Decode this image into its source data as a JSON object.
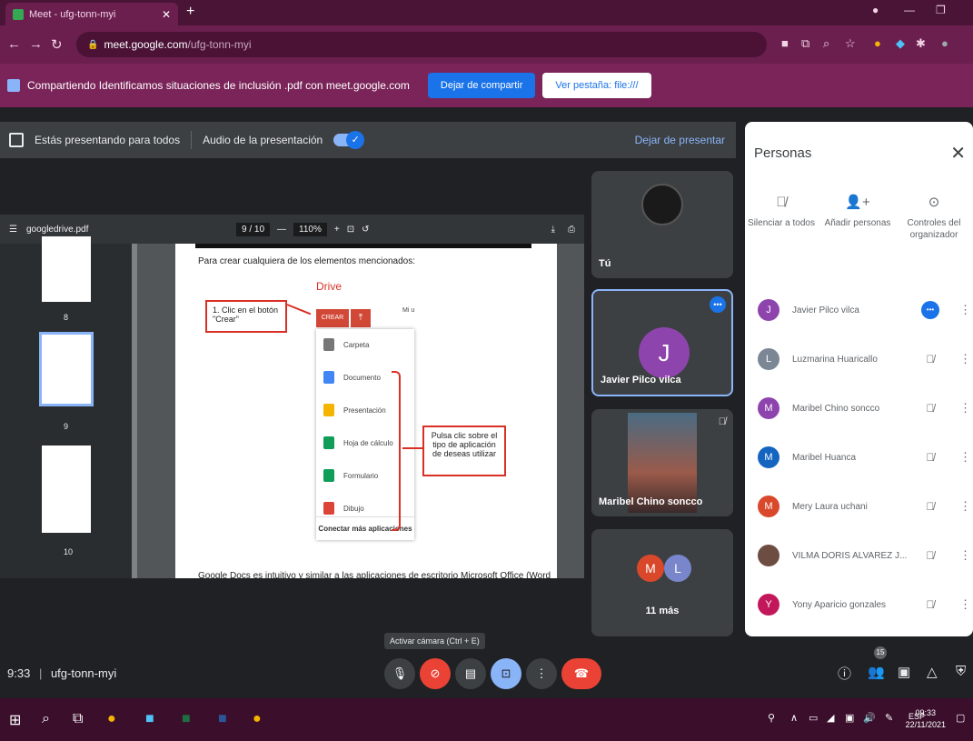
{
  "browser": {
    "tab_title": "Meet - ufg-tonn-myi",
    "url_host": "meet.google.com",
    "url_path": "/ufg-tonn-myi"
  },
  "share_bar": {
    "text": "Compartiendo Identificamos situaciones de inclusión .pdf con meet.google.com",
    "stop_button": "Dejar de compartir",
    "view_tab_button": "Ver pestaña: file:///"
  },
  "presenting_bar": {
    "presenting_text": "Estás presentando para todos",
    "audio_label": "Audio de la presentación",
    "stop_present": "Dejar de presentar"
  },
  "pdf": {
    "filename": "googledrive.pdf",
    "page_indicator": "9 / 10",
    "zoom": "110%",
    "thumb_labels": [
      "8",
      "9",
      "10"
    ],
    "intro": "Para crear cualquiera de los elementos mencionados:",
    "drive_label": "Drive",
    "callout1": "1. Clic en el botón \"Crear\"",
    "crear_btn": "CREAR",
    "mis_label": "Mi u",
    "menu_items": [
      "Carpeta",
      "Documento",
      "Presentación",
      "Hoja de cálculo",
      "Formulario",
      "Dibujo"
    ],
    "connect_label": "Conectar más aplicaciones",
    "callout2": "Pulsa clic sobre el tipo de aplicación de deseas utilizar",
    "footer_text": "Google Docs es intuitivo y similar a las aplicaciones de escritorio Microsoft Office (Word"
  },
  "tiles": {
    "me": "Tú",
    "javier": "Javier Pilco vilca",
    "javier_initial": "J",
    "maribel": "Maribel Chino soncco",
    "more_label": "11 más",
    "more_initials": [
      "M",
      "L"
    ]
  },
  "people_panel": {
    "title": "Personas",
    "controls": [
      "Silenciar a todos",
      "Añadir personas",
      "Controles del organizador"
    ],
    "participants": [
      {
        "initial": "J",
        "name": "Javier Pilco vilca",
        "color": "#8e44ad"
      },
      {
        "initial": "L",
        "name": "Luzmarina Huaricallo",
        "color": "#7b8794"
      },
      {
        "initial": "M",
        "name": "Maribel Chino soncco",
        "color": "#8e44ad"
      },
      {
        "initial": "M",
        "name": "Maribel Huanca",
        "color": "#1565c0"
      },
      {
        "initial": "M",
        "name": "Mery Laura uchani",
        "color": "#d9482b"
      },
      {
        "initial": "",
        "name": "VILMA DORIS ALVAREZ J...",
        "color": "#6d4c41"
      },
      {
        "initial": "Y",
        "name": "Yony Aparicio gonzales",
        "color": "#c2185b"
      }
    ]
  },
  "controls": {
    "tooltip": "Activar cámara (Ctrl + E)",
    "time": "9:33",
    "meeting_code": "ufg-tonn-myi",
    "people_count": "15"
  },
  "taskbar": {
    "lang": "ESP",
    "time": "09:33",
    "date": "22/11/2021"
  },
  "colors": {
    "chrome_dark": "#4a1436",
    "meet_bg": "#202124",
    "accent": "#1a73e8",
    "danger": "#ea4335"
  }
}
